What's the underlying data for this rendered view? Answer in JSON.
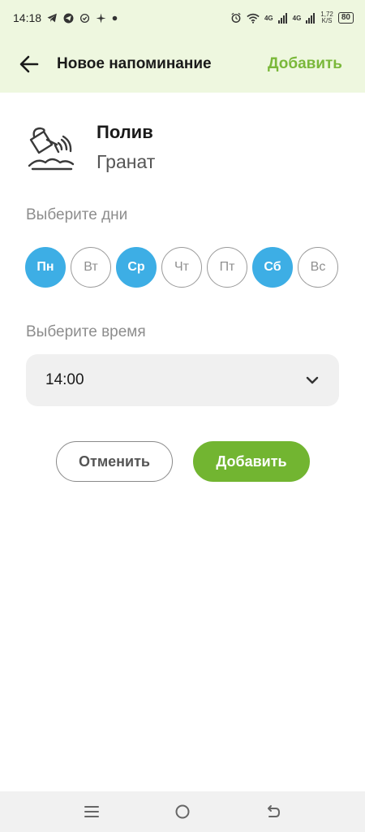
{
  "status_bar": {
    "time": "14:18",
    "network_1": "4G",
    "network_2": "4G",
    "speed_value": "1,72",
    "speed_unit": "K/S",
    "battery": "80",
    "notification_icons": [
      "telegram-icon",
      "telegram-icon",
      "sync-icon",
      "sparkle-icon",
      "dot-icon"
    ],
    "status_icons": [
      "alarm-icon",
      "wifi-icon",
      "signal-icon",
      "signal-icon",
      "battery-icon"
    ]
  },
  "app_bar": {
    "title": "Новое напоминание",
    "action_label": "Добавить",
    "back_icon": "arrow-left-icon",
    "action_color": "#7ab83a"
  },
  "reminder": {
    "icon": "watering-can-icon",
    "task": "Полив",
    "plant": "Гранат"
  },
  "days_section": {
    "label": "Выберите дни",
    "days": [
      {
        "label": "Пн",
        "selected": true
      },
      {
        "label": "Вт",
        "selected": false
      },
      {
        "label": "Ср",
        "selected": true
      },
      {
        "label": "Чт",
        "selected": false
      },
      {
        "label": "Пт",
        "selected": false
      },
      {
        "label": "Сб",
        "selected": true
      },
      {
        "label": "Вс",
        "selected": false
      }
    ],
    "selected_color": "#3daee5"
  },
  "time_section": {
    "label": "Выберите время",
    "value": "14:00",
    "chevron_icon": "chevron-down-icon"
  },
  "buttons": {
    "cancel_label": "Отменить",
    "add_label": "Добавить",
    "add_color": "#72b531"
  },
  "nav_bar": {
    "icons": [
      "menu-icon",
      "home-icon",
      "back-icon"
    ]
  }
}
